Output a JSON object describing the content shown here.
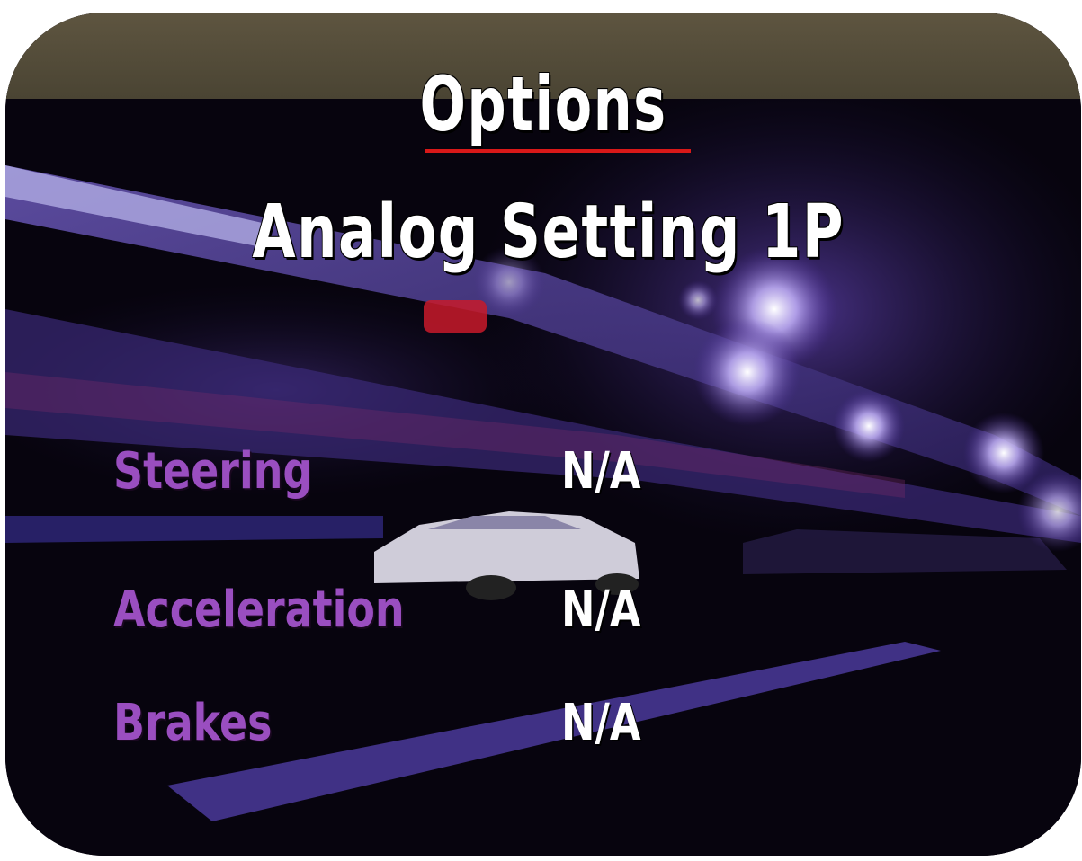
{
  "menu": {
    "title": "Options",
    "subtitle": "Analog Setting 1P",
    "rows": [
      {
        "label": "Steering",
        "value": "N/A"
      },
      {
        "label": "Acceleration",
        "value": "N/A"
      },
      {
        "label": "Brakes",
        "value": "N/A"
      }
    ]
  },
  "colors": {
    "title_text": "#ffffff",
    "title_underline": "#d81818",
    "label_text": "#9a4ec0",
    "value_text": "#ffffff",
    "band": "#5e5540",
    "background": "#07040e"
  }
}
